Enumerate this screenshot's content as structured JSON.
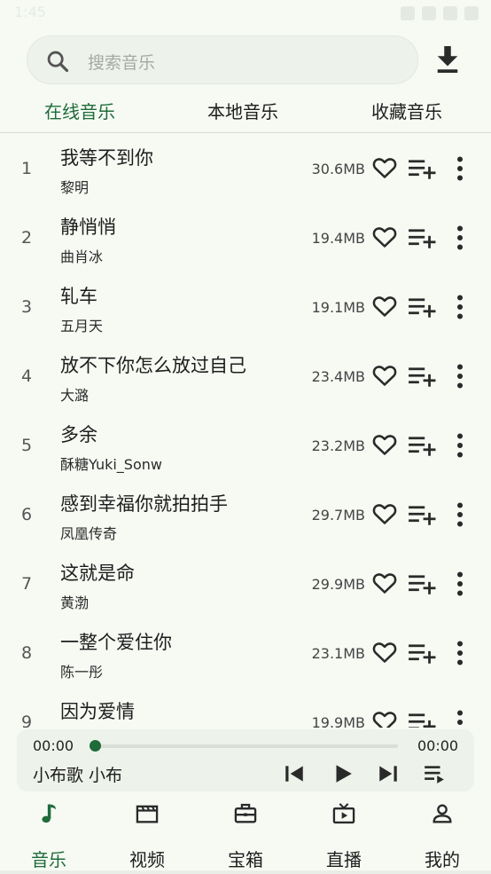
{
  "status_bar": {
    "time": "1:45"
  },
  "search": {
    "placeholder": "搜索音乐"
  },
  "tabs": [
    {
      "label": "在线音乐",
      "active": true
    },
    {
      "label": "本地音乐",
      "active": false
    },
    {
      "label": "收藏音乐",
      "active": false
    }
  ],
  "songs": [
    {
      "index": "1",
      "title": "我等不到你",
      "artist": "黎明",
      "size": "30.6MB"
    },
    {
      "index": "2",
      "title": "静悄悄",
      "artist": "曲肖冰",
      "size": "19.4MB"
    },
    {
      "index": "3",
      "title": "轧车",
      "artist": "五月天",
      "size": "19.1MB"
    },
    {
      "index": "4",
      "title": "放不下你怎么放过自己",
      "artist": "大潞",
      "size": "23.4MB"
    },
    {
      "index": "5",
      "title": "多余",
      "artist": "酥糖Yuki_Sonw",
      "size": "23.2MB"
    },
    {
      "index": "6",
      "title": "感到幸福你就拍拍手",
      "artist": "凤凰传奇",
      "size": "29.7MB"
    },
    {
      "index": "7",
      "title": "这就是命",
      "artist": "黄渤",
      "size": "29.9MB"
    },
    {
      "index": "8",
      "title": "一整个爱住你",
      "artist": "陈一彤",
      "size": "23.1MB"
    },
    {
      "index": "9",
      "title": "因为爱情",
      "artist": "",
      "size": "19.9MB"
    }
  ],
  "player": {
    "current_time": "00:00",
    "total_time": "00:00",
    "progress": 0,
    "now_playing": "小布歌 小布"
  },
  "bottom_nav": [
    {
      "label": "音乐",
      "icon": "music-note-icon",
      "active": true
    },
    {
      "label": "视频",
      "icon": "video-icon",
      "active": false
    },
    {
      "label": "宝箱",
      "icon": "treasure-box-icon",
      "active": false
    },
    {
      "label": "直播",
      "icon": "live-tv-icon",
      "active": false
    },
    {
      "label": "我的",
      "icon": "person-icon",
      "active": false
    }
  ],
  "colors": {
    "accent": "#1f6b3a",
    "background": "#f6faf3",
    "surface": "#edf2ea"
  }
}
